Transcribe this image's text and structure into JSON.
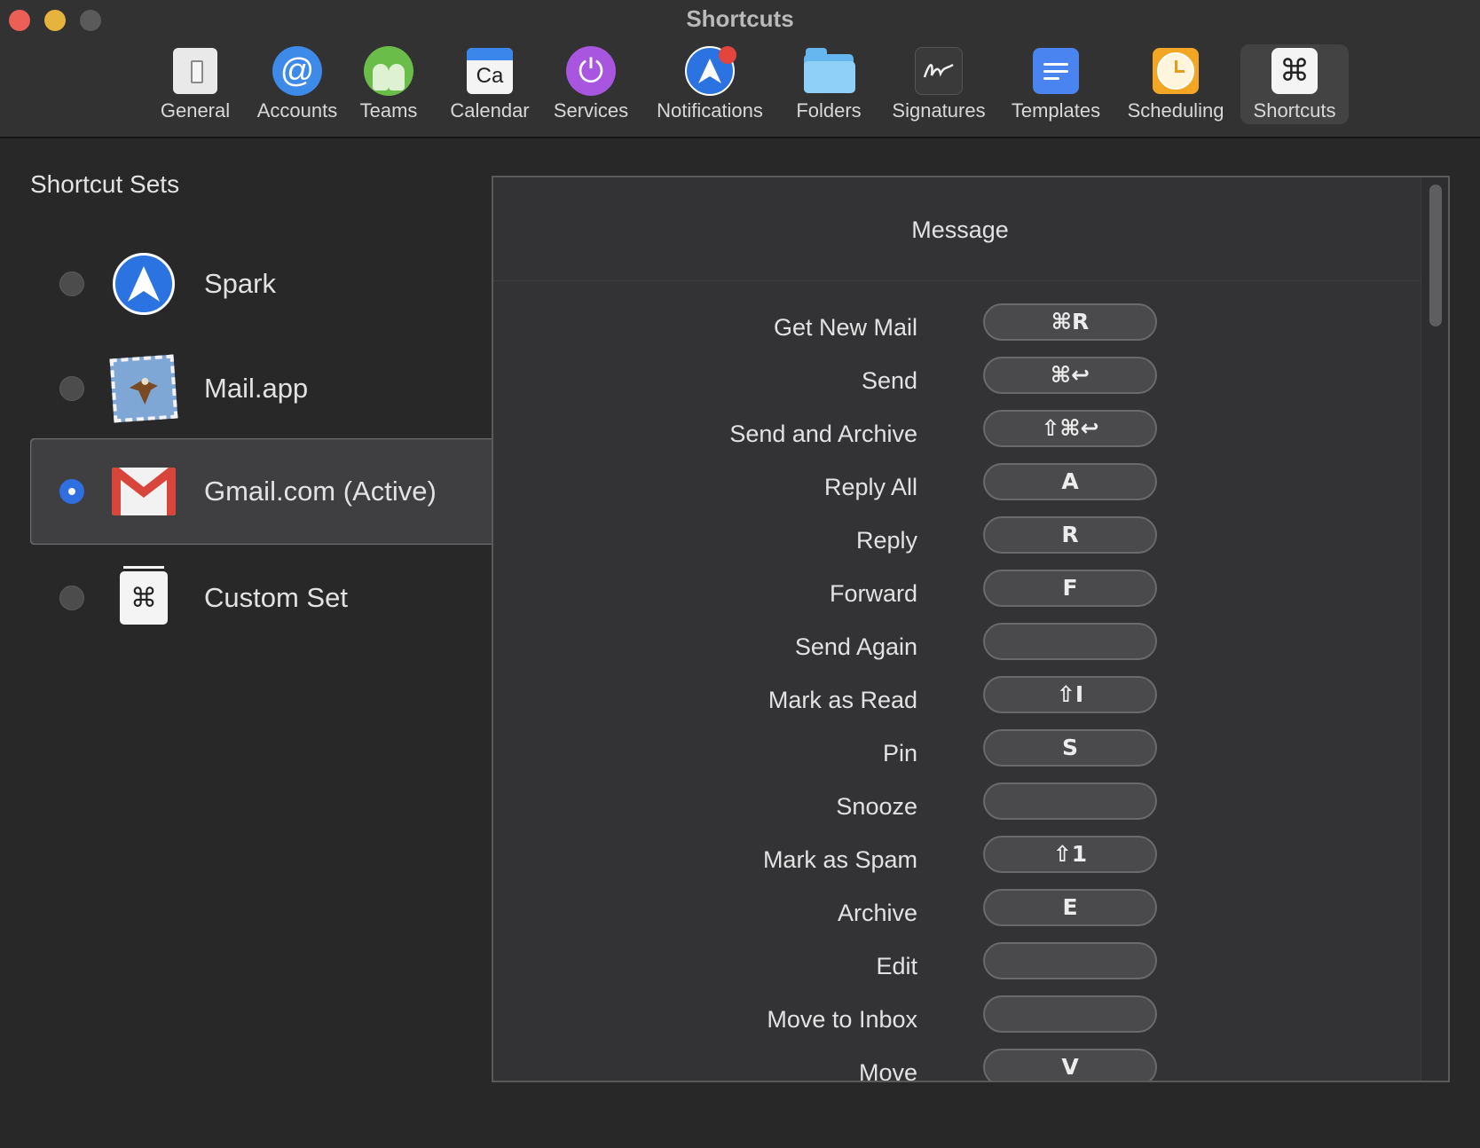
{
  "window": {
    "title": "Shortcuts"
  },
  "toolbar": {
    "items": [
      {
        "label": "General",
        "icon": "general-icon"
      },
      {
        "label": "Accounts",
        "icon": "at-sign-icon"
      },
      {
        "label": "Teams",
        "icon": "teams-icon"
      },
      {
        "label": "Calendar",
        "icon": "calendar-icon"
      },
      {
        "label": "Services",
        "icon": "power-icon"
      },
      {
        "label": "Notifications",
        "icon": "spark-icon"
      },
      {
        "label": "Folders",
        "icon": "folder-icon"
      },
      {
        "label": "Signatures",
        "icon": "signature-icon"
      },
      {
        "label": "Templates",
        "icon": "templates-icon"
      },
      {
        "label": "Scheduling",
        "icon": "clock-icon"
      },
      {
        "label": "Shortcuts",
        "icon": "command-icon"
      }
    ],
    "selected": "Shortcuts",
    "calendar_icon_text": "Ca",
    "command_glyph": "⌘",
    "accounts_glyph": "@",
    "services_glyph": "⏻"
  },
  "sidebar": {
    "title": "Shortcut Sets",
    "sets": [
      {
        "label": "Spark",
        "icon": "spark-icon",
        "selected": false
      },
      {
        "label": "Mail.app",
        "icon": "mail-app-icon",
        "selected": false
      },
      {
        "label": "Gmail.com (Active)",
        "icon": "gmail-icon",
        "selected": true
      },
      {
        "label": "Custom Set",
        "icon": "command-icon",
        "selected": false
      }
    ]
  },
  "panel": {
    "section_title": "Message",
    "shortcuts": [
      {
        "action": "Get New Mail",
        "key": "⌘R"
      },
      {
        "action": "Send",
        "key": "⌘↩"
      },
      {
        "action": "Send and Archive",
        "key": "⇧⌘↩"
      },
      {
        "action": "Reply All",
        "key": "A"
      },
      {
        "action": "Reply",
        "key": "R"
      },
      {
        "action": "Forward",
        "key": "F"
      },
      {
        "action": "Send Again",
        "key": ""
      },
      {
        "action": "Mark as Read",
        "key": "⇧I"
      },
      {
        "action": "Pin",
        "key": "S"
      },
      {
        "action": "Snooze",
        "key": ""
      },
      {
        "action": "Mark as Spam",
        "key": "⇧1"
      },
      {
        "action": "Archive",
        "key": "E"
      },
      {
        "action": "Edit",
        "key": ""
      },
      {
        "action": "Move to Inbox",
        "key": ""
      },
      {
        "action": "Move",
        "key": "V"
      }
    ]
  },
  "colors": {
    "accent": "#2f6fe0",
    "background": "#282828",
    "panel": "#333335"
  }
}
